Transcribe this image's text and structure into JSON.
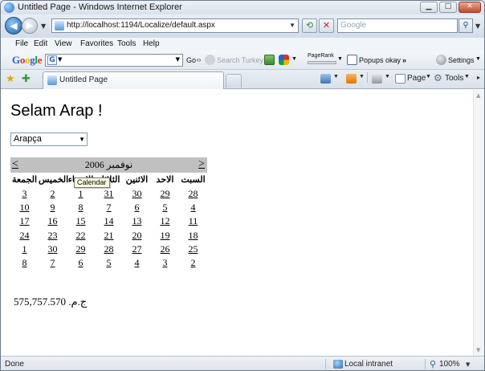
{
  "window": {
    "title": "Untitled Page - Windows Internet Explorer"
  },
  "address": {
    "url": "http://localhost:1194/Localize/default.aspx",
    "search_placeholder": "Google"
  },
  "menu": [
    "File",
    "Edit",
    "View",
    "Favorites",
    "Tools",
    "Help"
  ],
  "google_toolbar": {
    "logo": [
      "G",
      "o",
      "o",
      "g",
      "l",
      "e"
    ],
    "go_label": "Go",
    "search_label": "Search Turkey",
    "pagerank_label": "PageRank",
    "popups_label": "Popups okay",
    "settings_label": "Settings"
  },
  "tabs": [
    {
      "label": "Untitled Page"
    }
  ],
  "command_bar": {
    "page_label": "Page",
    "tools_label": "Tools"
  },
  "page": {
    "heading": "Selam Arap !",
    "language_select": {
      "selected": "Arapça"
    },
    "calendar": {
      "prev": "<",
      "next": ">",
      "month_title": "نوفمبر 2006",
      "days_of_week": [
        "الجمعة",
        "الخميس",
        "الاربعاء",
        "الثلاثاء",
        "الاثنين",
        "الاحد",
        "السبت"
      ],
      "weeks": [
        [
          "3",
          "2",
          "1",
          "31",
          "30",
          "29",
          "28"
        ],
        [
          "10",
          "9",
          "8",
          "7",
          "6",
          "5",
          "4"
        ],
        [
          "17",
          "16",
          "15",
          "14",
          "13",
          "12",
          "11"
        ],
        [
          "24",
          "23",
          "22",
          "21",
          "20",
          "19",
          "18"
        ],
        [
          "1",
          "30",
          "29",
          "28",
          "27",
          "26",
          "25"
        ],
        [
          "8",
          "7",
          "6",
          "5",
          "4",
          "3",
          "2"
        ]
      ],
      "tooltip": "Calendar"
    },
    "amount": "ج.م. 575,757.570"
  },
  "status": {
    "text": "Done",
    "zone": "Local intranet",
    "zoom": "100%"
  },
  "colors": {
    "calendar_title_bg": "#c0c0c0",
    "tooltip_bg": "#ffffe1"
  }
}
